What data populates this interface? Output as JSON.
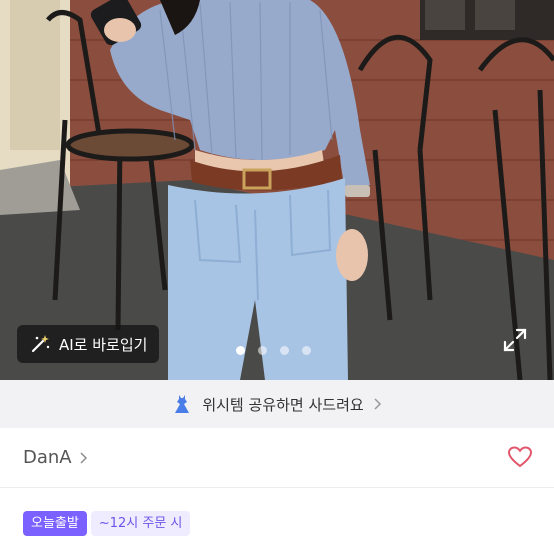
{
  "photo": {
    "alt_label": "product-photo"
  },
  "ai_button": {
    "label": "AI로 바로입기"
  },
  "carousel": {
    "total": 4,
    "active": 1
  },
  "wish_banner": {
    "text": "위시템 공유하면 사드려요"
  },
  "seller": {
    "name": "DanA"
  },
  "badges": {
    "today": "오늘출발",
    "cutoff": "~12시 주문 시"
  },
  "colors": {
    "accent": "#7b61ff",
    "heart": "#e0566b",
    "banner_bg": "#f2f2f4"
  }
}
